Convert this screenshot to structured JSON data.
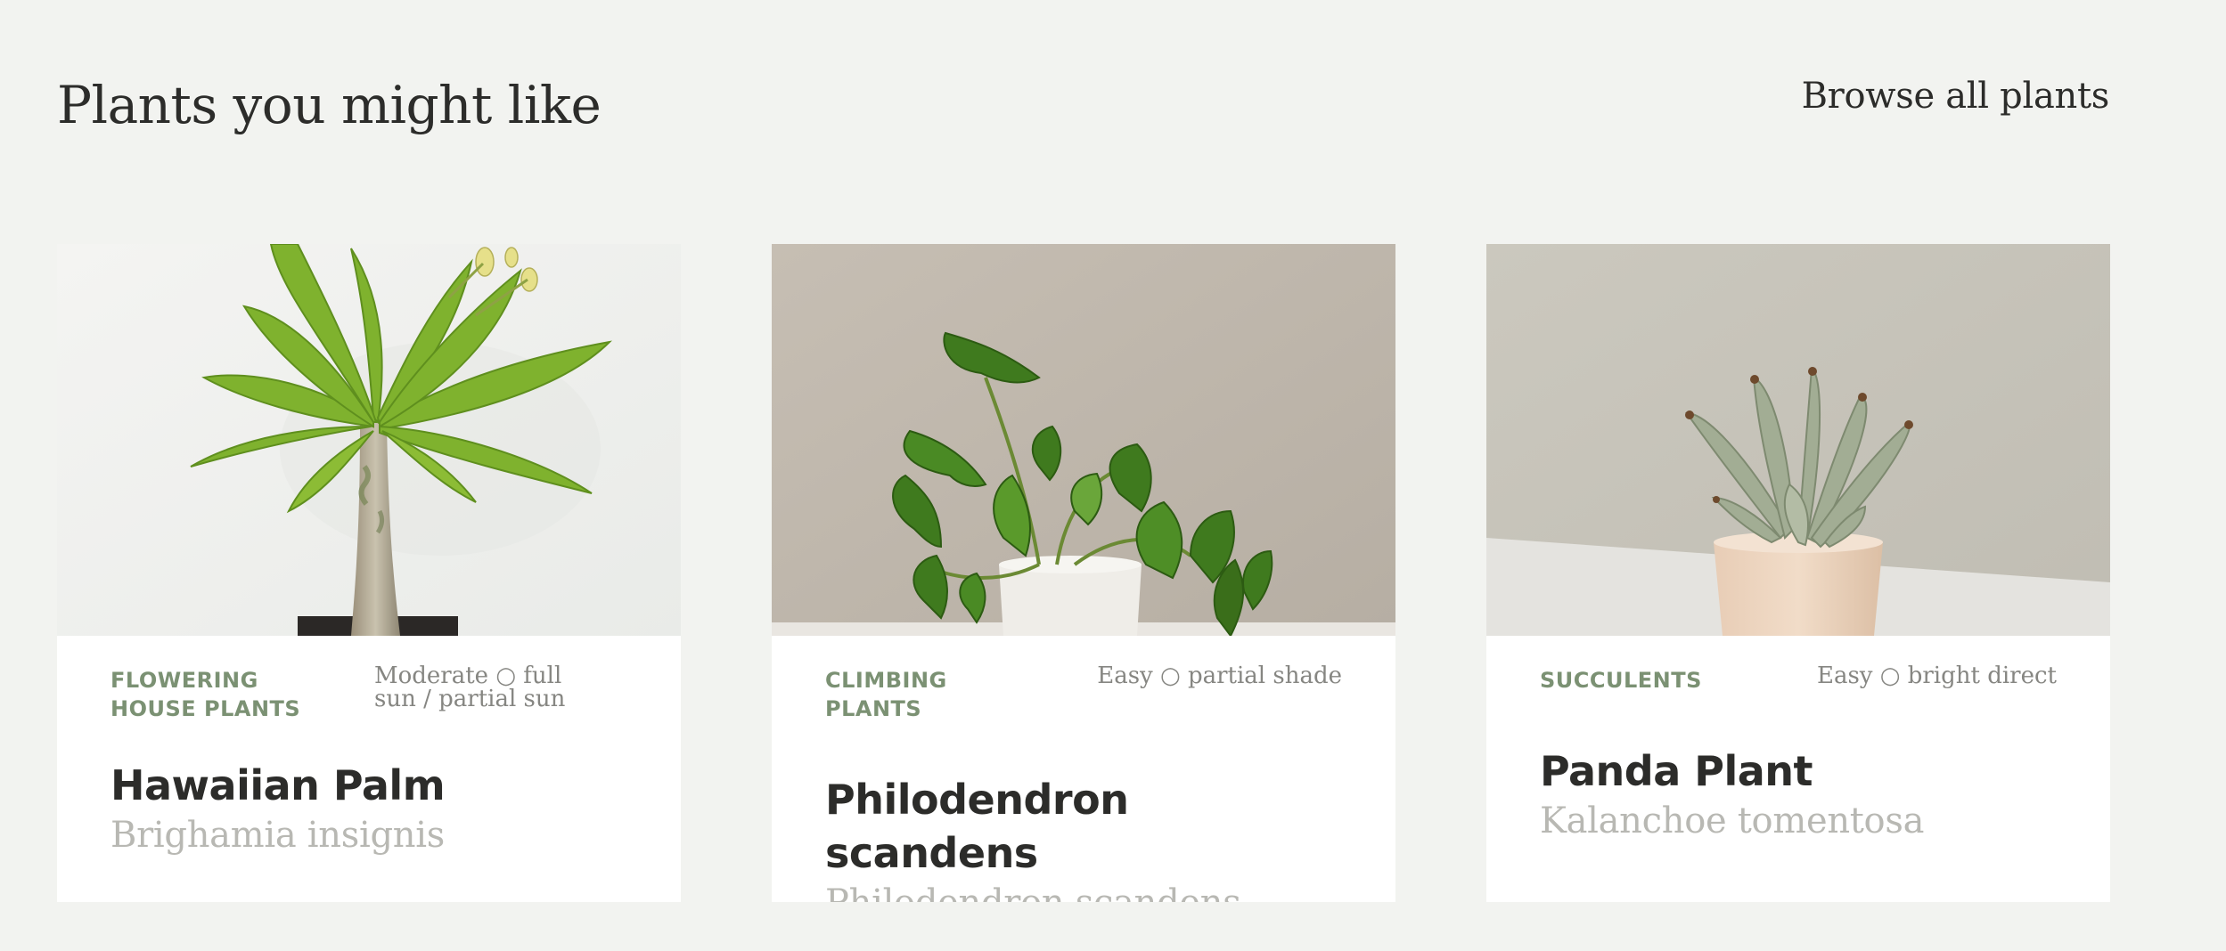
{
  "header": {
    "title": "Plants you might like",
    "browse_label": "Browse all plants"
  },
  "cards": [
    {
      "category": "Flowering House Plants",
      "care": "Moderate ○ full sun / partial sun",
      "name": "Hawaiian Palm",
      "latin": "Brighamia insignis"
    },
    {
      "category": "Climbing Plants",
      "care": "Easy ○ partial shade",
      "name": "Philodendron scandens",
      "latin": "Philodendron scandens"
    },
    {
      "category": "Succulents",
      "care": "Easy ○ bright direct",
      "name": "Panda Plant",
      "latin": "Kalanchoe tomentosa"
    }
  ],
  "colors": {
    "background": "#f2f3f0",
    "card": "#ffffff",
    "category": "#7b9173",
    "heading": "#2c2c2a",
    "latin": "#b8b8b3"
  }
}
